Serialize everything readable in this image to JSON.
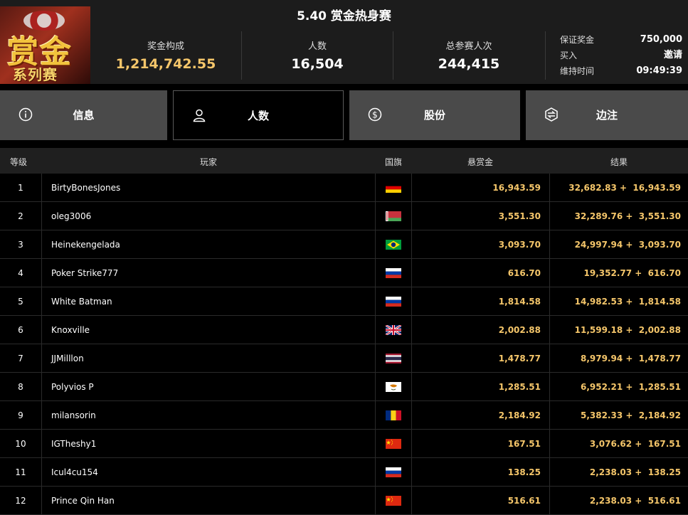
{
  "header": {
    "title": "5.40 赏金热身赛",
    "logo_line1": "赏金",
    "logo_line2": "系列赛",
    "stats": [
      {
        "label": "奖金构成",
        "value": "1,214,742.55"
      },
      {
        "label": "人数",
        "value": "16,504"
      },
      {
        "label": "总参赛人次",
        "value": "244,415"
      }
    ],
    "info": [
      {
        "key": "保证奖金",
        "value": "750,000"
      },
      {
        "key": "买入",
        "value": "邀请"
      },
      {
        "key": "维持时间",
        "value": "09:49:39"
      }
    ]
  },
  "tabs": [
    {
      "label": "信息",
      "icon": "info-icon"
    },
    {
      "label": "人数",
      "icon": "user-icon",
      "active": true
    },
    {
      "label": "股份",
      "icon": "dollar-coin-icon"
    },
    {
      "label": "边注",
      "icon": "side-bet-icon"
    }
  ],
  "table": {
    "columns": {
      "rank": "等级",
      "player": "玩家",
      "flag": "国旗",
      "bounty": "悬赏金",
      "result": "结果"
    },
    "rows": [
      {
        "rank": "1",
        "player": "BirtyBonesJones",
        "flag": "germany",
        "bounty": "16,943.59",
        "result": "32,682.83 +  16,943.59"
      },
      {
        "rank": "2",
        "player": "oleg3006",
        "flag": "belarus",
        "bounty": "3,551.30",
        "result": "32,289.76 +  3,551.30"
      },
      {
        "rank": "3",
        "player": "Heinekengelada",
        "flag": "brazil",
        "bounty": "3,093.70",
        "result": "24,997.94 +  3,093.70"
      },
      {
        "rank": "4",
        "player": "Poker Strike777",
        "flag": "russia",
        "bounty": "616.70",
        "result": "19,352.77 +  616.70"
      },
      {
        "rank": "5",
        "player": "White Batman",
        "flag": "russia",
        "bounty": "1,814.58",
        "result": "14,982.53 +  1,814.58"
      },
      {
        "rank": "6",
        "player": "Knoxville",
        "flag": "uk",
        "bounty": "2,002.88",
        "result": "11,599.18 +  2,002.88"
      },
      {
        "rank": "7",
        "player": "JJMilllon",
        "flag": "thailand",
        "bounty": "1,478.77",
        "result": "8,979.94 +  1,478.77"
      },
      {
        "rank": "8",
        "player": "Polyvios P",
        "flag": "cyprus",
        "bounty": "1,285.51",
        "result": "6,952.21 +  1,285.51"
      },
      {
        "rank": "9",
        "player": "milansorin",
        "flag": "romania",
        "bounty": "2,184.92",
        "result": "5,382.33 +  2,184.92"
      },
      {
        "rank": "10",
        "player": "IGTheshy1",
        "flag": "china",
        "bounty": "167.51",
        "result": "3,076.62 +  167.51"
      },
      {
        "rank": "11",
        "player": "Icul4cu154",
        "flag": "russia",
        "bounty": "138.25",
        "result": "2,238.03 +  138.25"
      },
      {
        "rank": "12",
        "player": "Prince Qin Han",
        "flag": "china",
        "bounty": "516.61",
        "result": "2,238.03 +  516.61"
      }
    ]
  },
  "colors": {
    "gold": "#f5c66a",
    "tab_bg": "#4a4a4a",
    "header_bg": "#1c1c1c"
  }
}
